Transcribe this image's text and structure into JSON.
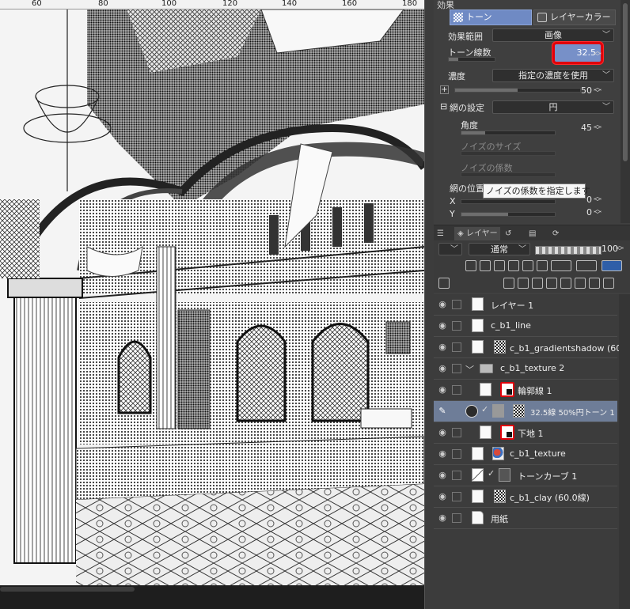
{
  "ruler": {
    "marks": [
      "60",
      "80",
      "100",
      "120",
      "140",
      "160",
      "180"
    ]
  },
  "effect": {
    "header": "効果",
    "tab_tone": "トーン",
    "tab_layer_color": "レイヤーカラー",
    "range_label": "効果範囲",
    "range_value": "画像",
    "lines_label": "トーン線数",
    "lines_value": "32.5",
    "density_label": "濃度",
    "density_value": "指定の濃度を使用",
    "density_number": "50",
    "density_fraction": 0.5,
    "screen_label": "網の設定",
    "screen_value": "円",
    "angle_label": "角度",
    "angle_value": "45",
    "angle_fraction": 0.25,
    "noise_size_label": "ノイズのサイズ",
    "noise_factor_label": "ノイズの係数",
    "position_label": "網の位置",
    "x_label": "X",
    "x_value": "0",
    "y_label": "Y",
    "y_value": "0",
    "tooltip": "ノイズの係数を指定します"
  },
  "layer_palette": {
    "tab_label": "レイヤー",
    "blend_mode": "通常",
    "opacity": "100",
    "layers": [
      {
        "name": "レイヤー 1",
        "thumb": "plain",
        "indent": 0
      },
      {
        "name": "c_b1_line",
        "thumb": "plain",
        "indent": 0
      },
      {
        "name": "c_b1_gradientshadow (60.0線)",
        "thumb": "pattern",
        "indent": 0
      },
      {
        "name": "c_b1_texture 2",
        "thumb": "folder",
        "indent": 0
      },
      {
        "name": "輪郭線 1",
        "thumb": "mask",
        "indent": 1
      },
      {
        "name": "32.5線 50%円トーン 1",
        "thumb": "tone",
        "indent": 1,
        "selected": true
      },
      {
        "name": "下地 1",
        "thumb": "mask",
        "indent": 1
      },
      {
        "name": "c_b1_texture",
        "thumb": "color",
        "indent": 0
      },
      {
        "name": "トーンカーブ 1",
        "thumb": "curve",
        "indent": 0
      },
      {
        "name": "c_b1_clay (60.0線)",
        "thumb": "pattern",
        "indent": 0
      },
      {
        "name": "用紙",
        "thumb": "paper",
        "indent": 0
      }
    ]
  },
  "colors": {
    "accent_tab": "#6f8ac4",
    "highlight_box": "#e0000a",
    "selected_layer": "#6e7d98"
  }
}
